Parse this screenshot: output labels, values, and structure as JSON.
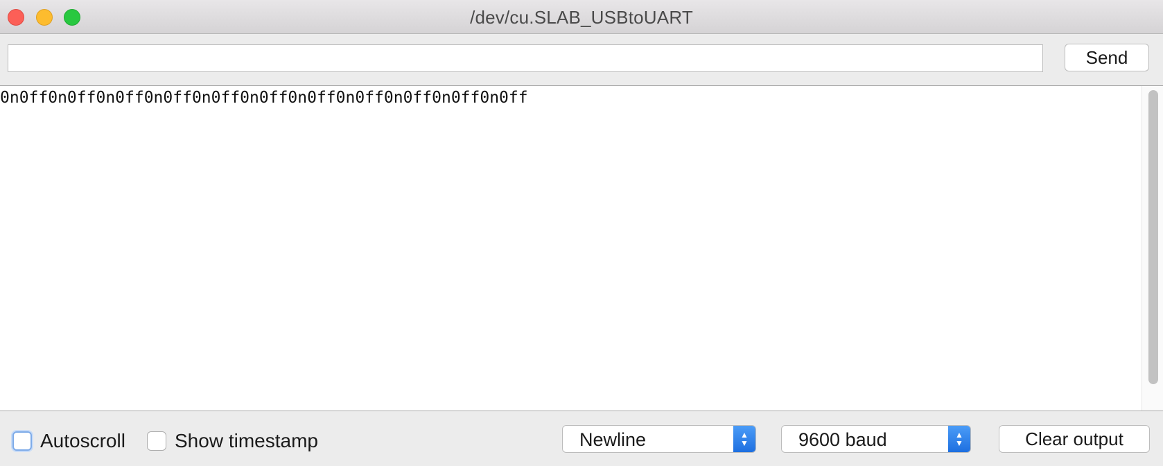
{
  "window": {
    "title": "/dev/cu.SLAB_USBtoUART"
  },
  "send_row": {
    "input_value": "",
    "send_label": "Send"
  },
  "output": {
    "text": "0n0ff0n0ff0n0ff0n0ff0n0ff0n0ff0n0ff0n0ff0n0ff0n0ff0n0ff"
  },
  "bottom_bar": {
    "autoscroll_label": "Autoscroll",
    "autoscroll_checked": false,
    "timestamp_label": "Show timestamp",
    "timestamp_checked": false,
    "line_ending": {
      "selected": "Newline"
    },
    "baud_rate": {
      "selected": "9600 baud"
    },
    "clear_label": "Clear output"
  },
  "colors": {
    "close": "#fc5f57",
    "minimize": "#fdbc2e",
    "maximize": "#28c840",
    "select_accent": "#1d6fe0"
  }
}
